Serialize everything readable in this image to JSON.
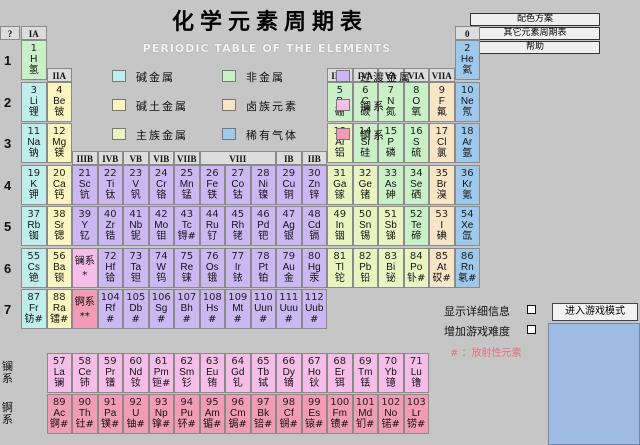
{
  "title": "化学元素周期表",
  "subtitle": "PERIODIC TABLE OF THE ELEMENTS",
  "menu": [
    "配色方案",
    "其它元素周期表",
    "帮助"
  ],
  "question_mark": "?",
  "corner_zero": "0",
  "colors": {
    "alkali": "#bfeeed",
    "alkaline": "#fbf6bf",
    "transition": "#cbb8f2",
    "nonmetal": "#c9f0c6",
    "halogen": "#f8e5c5",
    "noble": "#9ec9ec",
    "poor": "#e9f4c1",
    "lanthanide": "#f6bde9",
    "actinide": "#f19bb6",
    "hydrogen": "#c9f0c6",
    "header": "#dcdcdc"
  },
  "legend": [
    {
      "label": "碱金属",
      "color": "#bfeeed"
    },
    {
      "label": "非金属",
      "color": "#c9f0c6"
    },
    {
      "label": "过渡金属",
      "color": "#cbb8f2"
    },
    {
      "label": "碱土金属",
      "color": "#fbf6bf"
    },
    {
      "label": "卤族元素",
      "color": "#f8e5c5"
    },
    {
      "label": "镧系",
      "color": "#f6bde9"
    },
    {
      "label": "主族金属",
      "color": "#e9f4c1"
    },
    {
      "label": "稀有气体",
      "color": "#9ec9ec"
    },
    {
      "label": "锕系",
      "color": "#f19bb6"
    }
  ],
  "periods": [
    "1",
    "2",
    "3",
    "4",
    "5",
    "6",
    "7"
  ],
  "group_headers": [
    {
      "label": "IA",
      "col": 1,
      "row": 0
    },
    {
      "label": "IIA",
      "col": 2,
      "row": 1
    },
    {
      "label": "IIIA",
      "col": 13,
      "row": 1
    },
    {
      "label": "IVA",
      "col": 14,
      "row": 1
    },
    {
      "label": "VA",
      "col": 15,
      "row": 1
    },
    {
      "label": "VIA",
      "col": 16,
      "row": 1
    },
    {
      "label": "VIIA",
      "col": 17,
      "row": 1
    },
    {
      "label": "IIIB",
      "col": 3,
      "row": 3
    },
    {
      "label": "IVB",
      "col": 4,
      "row": 3
    },
    {
      "label": "VB",
      "col": 5,
      "row": 3
    },
    {
      "label": "VIB",
      "col": 6,
      "row": 3
    },
    {
      "label": "VIIB",
      "col": 7,
      "row": 3
    },
    {
      "label": "VIII",
      "col": 8,
      "row": 3,
      "span": 3
    },
    {
      "label": "IB",
      "col": 11,
      "row": 3
    },
    {
      "label": "IIB",
      "col": 12,
      "row": 3
    }
  ],
  "elements": [
    {
      "n": "1",
      "s": "H",
      "c": "氢",
      "t": "hydrogen",
      "col": 1,
      "row": 1
    },
    {
      "n": "2",
      "s": "He",
      "c": "氦",
      "t": "noble",
      "col": 18,
      "row": 1
    },
    {
      "n": "3",
      "s": "Li",
      "c": "锂",
      "t": "alkali",
      "col": 1,
      "row": 2
    },
    {
      "n": "4",
      "s": "Be",
      "c": "铍",
      "t": "alkaline",
      "col": 2,
      "row": 2
    },
    {
      "n": "5",
      "s": "B",
      "c": "硼",
      "t": "nonmetal",
      "col": 13,
      "row": 2
    },
    {
      "n": "6",
      "s": "C",
      "c": "碳",
      "t": "nonmetal",
      "col": 14,
      "row": 2
    },
    {
      "n": "7",
      "s": "N",
      "c": "氮",
      "t": "nonmetal",
      "col": 15,
      "row": 2
    },
    {
      "n": "8",
      "s": "O",
      "c": "氧",
      "t": "nonmetal",
      "col": 16,
      "row": 2
    },
    {
      "n": "9",
      "s": "F",
      "c": "氟",
      "t": "halogen",
      "col": 17,
      "row": 2
    },
    {
      "n": "10",
      "s": "Ne",
      "c": "氖",
      "t": "noble",
      "col": 18,
      "row": 2
    },
    {
      "n": "11",
      "s": "Na",
      "c": "钠",
      "t": "alkali",
      "col": 1,
      "row": 3
    },
    {
      "n": "12",
      "s": "Mg",
      "c": "镁",
      "t": "alkaline",
      "col": 2,
      "row": 3
    },
    {
      "n": "13",
      "s": "Al",
      "c": "铝",
      "t": "poor",
      "col": 13,
      "row": 3
    },
    {
      "n": "14",
      "s": "Si",
      "c": "硅",
      "t": "nonmetal",
      "col": 14,
      "row": 3
    },
    {
      "n": "15",
      "s": "P",
      "c": "磷",
      "t": "nonmetal",
      "col": 15,
      "row": 3
    },
    {
      "n": "16",
      "s": "S",
      "c": "硫",
      "t": "nonmetal",
      "col": 16,
      "row": 3
    },
    {
      "n": "17",
      "s": "Cl",
      "c": "氯",
      "t": "halogen",
      "col": 17,
      "row": 3
    },
    {
      "n": "18",
      "s": "Ar",
      "c": "氩",
      "t": "noble",
      "col": 18,
      "row": 3
    },
    {
      "n": "19",
      "s": "K",
      "c": "钾",
      "t": "alkali",
      "col": 1,
      "row": 4
    },
    {
      "n": "20",
      "s": "Ca",
      "c": "钙",
      "t": "alkaline",
      "col": 2,
      "row": 4
    },
    {
      "n": "21",
      "s": "Sc",
      "c": "钪",
      "t": "transition",
      "col": 3,
      "row": 4
    },
    {
      "n": "22",
      "s": "Ti",
      "c": "钛",
      "t": "transition",
      "col": 4,
      "row": 4
    },
    {
      "n": "23",
      "s": "V",
      "c": "钒",
      "t": "transition",
      "col": 5,
      "row": 4
    },
    {
      "n": "24",
      "s": "Cr",
      "c": "铬",
      "t": "transition",
      "col": 6,
      "row": 4
    },
    {
      "n": "25",
      "s": "Mn",
      "c": "锰",
      "t": "transition",
      "col": 7,
      "row": 4
    },
    {
      "n": "26",
      "s": "Fe",
      "c": "铁",
      "t": "transition",
      "col": 8,
      "row": 4
    },
    {
      "n": "27",
      "s": "Co",
      "c": "钴",
      "t": "transition",
      "col": 9,
      "row": 4
    },
    {
      "n": "28",
      "s": "Ni",
      "c": "镍",
      "t": "transition",
      "col": 10,
      "row": 4
    },
    {
      "n": "29",
      "s": "Cu",
      "c": "铜",
      "t": "transition",
      "col": 11,
      "row": 4
    },
    {
      "n": "30",
      "s": "Zn",
      "c": "锌",
      "t": "transition",
      "col": 12,
      "row": 4
    },
    {
      "n": "31",
      "s": "Ga",
      "c": "镓",
      "t": "poor",
      "col": 13,
      "row": 4
    },
    {
      "n": "32",
      "s": "Ge",
      "c": "锗",
      "t": "poor",
      "col": 14,
      "row": 4
    },
    {
      "n": "33",
      "s": "As",
      "c": "砷",
      "t": "nonmetal",
      "col": 15,
      "row": 4
    },
    {
      "n": "34",
      "s": "Se",
      "c": "硒",
      "t": "nonmetal",
      "col": 16,
      "row": 4
    },
    {
      "n": "35",
      "s": "Br",
      "c": "溴",
      "t": "halogen",
      "col": 17,
      "row": 4
    },
    {
      "n": "36",
      "s": "Kr",
      "c": "氪",
      "t": "noble",
      "col": 18,
      "row": 4
    },
    {
      "n": "37",
      "s": "Rb",
      "c": "铷",
      "t": "alkali",
      "col": 1,
      "row": 5
    },
    {
      "n": "38",
      "s": "Sr",
      "c": "锶",
      "t": "alkaline",
      "col": 2,
      "row": 5
    },
    {
      "n": "39",
      "s": "Y",
      "c": "钇",
      "t": "transition",
      "col": 3,
      "row": 5
    },
    {
      "n": "40",
      "s": "Zr",
      "c": "锆",
      "t": "transition",
      "col": 4,
      "row": 5
    },
    {
      "n": "41",
      "s": "Nb",
      "c": "铌",
      "t": "transition",
      "col": 5,
      "row": 5
    },
    {
      "n": "42",
      "s": "Mo",
      "c": "钼",
      "t": "transition",
      "col": 6,
      "row": 5
    },
    {
      "n": "43",
      "s": "Tc",
      "c": "锝#",
      "t": "transition",
      "col": 7,
      "row": 5
    },
    {
      "n": "44",
      "s": "Ru",
      "c": "钌",
      "t": "transition",
      "col": 8,
      "row": 5
    },
    {
      "n": "45",
      "s": "Rh",
      "c": "铑",
      "t": "transition",
      "col": 9,
      "row": 5
    },
    {
      "n": "46",
      "s": "Pd",
      "c": "钯",
      "t": "transition",
      "col": 10,
      "row": 5
    },
    {
      "n": "47",
      "s": "Ag",
      "c": "银",
      "t": "transition",
      "col": 11,
      "row": 5
    },
    {
      "n": "48",
      "s": "Cd",
      "c": "镉",
      "t": "transition",
      "col": 12,
      "row": 5
    },
    {
      "n": "49",
      "s": "In",
      "c": "铟",
      "t": "poor",
      "col": 13,
      "row": 5
    },
    {
      "n": "50",
      "s": "Sn",
      "c": "锡",
      "t": "poor",
      "col": 14,
      "row": 5
    },
    {
      "n": "51",
      "s": "Sb",
      "c": "锑",
      "t": "poor",
      "col": 15,
      "row": 5
    },
    {
      "n": "52",
      "s": "Te",
      "c": "碲",
      "t": "nonmetal",
      "col": 16,
      "row": 5
    },
    {
      "n": "53",
      "s": "I",
      "c": "碘",
      "t": "halogen",
      "col": 17,
      "row": 5
    },
    {
      "n": "54",
      "s": "Xe",
      "c": "氙",
      "t": "noble",
      "col": 18,
      "row": 5
    },
    {
      "n": "55",
      "s": "Cs",
      "c": "铯",
      "t": "alkali",
      "col": 1,
      "row": 6
    },
    {
      "n": "56",
      "s": "Ba",
      "c": "钡",
      "t": "alkaline",
      "col": 2,
      "row": 6
    },
    {
      "n": "",
      "s": "镧系",
      "c": "*",
      "t": "lanthanide",
      "col": 3,
      "row": 6
    },
    {
      "n": "72",
      "s": "Hf",
      "c": "铪",
      "t": "transition",
      "col": 4,
      "row": 6
    },
    {
      "n": "73",
      "s": "Ta",
      "c": "钽",
      "t": "transition",
      "col": 5,
      "row": 6
    },
    {
      "n": "74",
      "s": "W",
      "c": "钨",
      "t": "transition",
      "col": 6,
      "row": 6
    },
    {
      "n": "75",
      "s": "Re",
      "c": "铼",
      "t": "transition",
      "col": 7,
      "row": 6
    },
    {
      "n": "76",
      "s": "Os",
      "c": "锇",
      "t": "transition",
      "col": 8,
      "row": 6
    },
    {
      "n": "77",
      "s": "Ir",
      "c": "铱",
      "t": "transition",
      "col": 9,
      "row": 6
    },
    {
      "n": "78",
      "s": "Pt",
      "c": "铂",
      "t": "transition",
      "col": 10,
      "row": 6
    },
    {
      "n": "79",
      "s": "Au",
      "c": "金",
      "t": "transition",
      "col": 11,
      "row": 6
    },
    {
      "n": "80",
      "s": "Hg",
      "c": "汞",
      "t": "transition",
      "col": 12,
      "row": 6
    },
    {
      "n": "81",
      "s": "Tl",
      "c": "铊",
      "t": "poor",
      "col": 13,
      "row": 6
    },
    {
      "n": "82",
      "s": "Pb",
      "c": "铅",
      "t": "poor",
      "col": 14,
      "row": 6
    },
    {
      "n": "83",
      "s": "Bi",
      "c": "铋",
      "t": "poor",
      "col": 15,
      "row": 6
    },
    {
      "n": "84",
      "s": "Po",
      "c": "钋#",
      "t": "poor",
      "col": 16,
      "row": 6
    },
    {
      "n": "85",
      "s": "At",
      "c": "砹#",
      "t": "halogen",
      "col": 17,
      "row": 6
    },
    {
      "n": "86",
      "s": "Rn",
      "c": "氡#",
      "t": "noble",
      "col": 18,
      "row": 6
    },
    {
      "n": "87",
      "s": "Fr",
      "c": "钫#",
      "t": "alkali",
      "col": 1,
      "row": 7
    },
    {
      "n": "88",
      "s": "Ra",
      "c": "镭#",
      "t": "alkaline",
      "col": 2,
      "row": 7
    },
    {
      "n": "",
      "s": "锕系",
      "c": "**",
      "t": "actinide",
      "col": 3,
      "row": 7
    },
    {
      "n": "104",
      "s": "Rf",
      "c": "#",
      "t": "transition",
      "col": 4,
      "row": 7
    },
    {
      "n": "105",
      "s": "Db",
      "c": "#",
      "t": "transition",
      "col": 5,
      "row": 7
    },
    {
      "n": "106",
      "s": "Sg",
      "c": "#",
      "t": "transition",
      "col": 6,
      "row": 7
    },
    {
      "n": "107",
      "s": "Bh",
      "c": "#",
      "t": "transition",
      "col": 7,
      "row": 7
    },
    {
      "n": "108",
      "s": "Hs",
      "c": "#",
      "t": "transition",
      "col": 8,
      "row": 7
    },
    {
      "n": "109",
      "s": "Mt",
      "c": "#",
      "t": "transition",
      "col": 9,
      "row": 7
    },
    {
      "n": "110",
      "s": "Uun",
      "c": "#",
      "t": "transition",
      "col": 10,
      "row": 7
    },
    {
      "n": "111",
      "s": "Uuu",
      "c": "#",
      "t": "transition",
      "col": 11,
      "row": 7
    },
    {
      "n": "112",
      "s": "Uub",
      "c": "#",
      "t": "transition",
      "col": 12,
      "row": 7
    },
    {
      "n": "57",
      "s": "La",
      "c": "镧",
      "t": "lanthanide",
      "col": 2,
      "row": 8.5
    },
    {
      "n": "58",
      "s": "Ce",
      "c": "铈",
      "t": "lanthanide",
      "col": 3,
      "row": 8.5
    },
    {
      "n": "59",
      "s": "Pr",
      "c": "镨",
      "t": "lanthanide",
      "col": 4,
      "row": 8.5
    },
    {
      "n": "60",
      "s": "Nd",
      "c": "钕",
      "t": "lanthanide",
      "col": 5,
      "row": 8.5
    },
    {
      "n": "61",
      "s": "Pm",
      "c": "钷#",
      "t": "lanthanide",
      "col": 6,
      "row": 8.5
    },
    {
      "n": "62",
      "s": "Sm",
      "c": "钐",
      "t": "lanthanide",
      "col": 7,
      "row": 8.5
    },
    {
      "n": "63",
      "s": "Eu",
      "c": "铕",
      "t": "lanthanide",
      "col": 8,
      "row": 8.5
    },
    {
      "n": "64",
      "s": "Gd",
      "c": "钆",
      "t": "lanthanide",
      "col": 9,
      "row": 8.5
    },
    {
      "n": "65",
      "s": "Tb",
      "c": "铽",
      "t": "lanthanide",
      "col": 10,
      "row": 8.5
    },
    {
      "n": "66",
      "s": "Dy",
      "c": "镝",
      "t": "lanthanide",
      "col": 11,
      "row": 8.5
    },
    {
      "n": "67",
      "s": "Ho",
      "c": "钬",
      "t": "lanthanide",
      "col": 12,
      "row": 8.5
    },
    {
      "n": "68",
      "s": "Er",
      "c": "铒",
      "t": "lanthanide",
      "col": 13,
      "row": 8.5
    },
    {
      "n": "69",
      "s": "Tm",
      "c": "铥",
      "t": "lanthanide",
      "col": 14,
      "row": 8.5
    },
    {
      "n": "70",
      "s": "Yb",
      "c": "镱",
      "t": "lanthanide",
      "col": 15,
      "row": 8.5
    },
    {
      "n": "71",
      "s": "Lu",
      "c": "镥",
      "t": "lanthanide",
      "col": 16,
      "row": 8.5
    },
    {
      "n": "89",
      "s": "Ac",
      "c": "锕#",
      "t": "actinide",
      "col": 2,
      "row": 9.5
    },
    {
      "n": "90",
      "s": "Th",
      "c": "钍#",
      "t": "actinide",
      "col": 3,
      "row": 9.5
    },
    {
      "n": "91",
      "s": "Pa",
      "c": "镤#",
      "t": "actinide",
      "col": 4,
      "row": 9.5
    },
    {
      "n": "92",
      "s": "U",
      "c": "铀#",
      "t": "actinide",
      "col": 5,
      "row": 9.5
    },
    {
      "n": "93",
      "s": "Np",
      "c": "镎#",
      "t": "actinide",
      "col": 6,
      "row": 9.5
    },
    {
      "n": "94",
      "s": "Pu",
      "c": "钚#",
      "t": "actinide",
      "col": 7,
      "row": 9.5
    },
    {
      "n": "95",
      "s": "Am",
      "c": "镅#",
      "t": "actinide",
      "col": 8,
      "row": 9.5
    },
    {
      "n": "96",
      "s": "Cm",
      "c": "锔#",
      "t": "actinide",
      "col": 9,
      "row": 9.5
    },
    {
      "n": "97",
      "s": "Bk",
      "c": "锫#",
      "t": "actinide",
      "col": 10,
      "row": 9.5
    },
    {
      "n": "98",
      "s": "Cf",
      "c": "锎#",
      "t": "actinide",
      "col": 11,
      "row": 9.5
    },
    {
      "n": "99",
      "s": "Es",
      "c": "锿#",
      "t": "actinide",
      "col": 12,
      "row": 9.5
    },
    {
      "n": "100",
      "s": "Fm",
      "c": "镄#",
      "t": "actinide",
      "col": 13,
      "row": 9.5
    },
    {
      "n": "101",
      "s": "Md",
      "c": "钔#",
      "t": "actinide",
      "col": 14,
      "row": 9.5
    },
    {
      "n": "102",
      "s": "No",
      "c": "锘#",
      "t": "actinide",
      "col": 15,
      "row": 9.5
    },
    {
      "n": "103",
      "s": "Lr",
      "c": "铹#",
      "t": "actinide",
      "col": 16,
      "row": 9.5
    }
  ],
  "series_labels": [
    "镧系",
    "锕系"
  ],
  "options": [
    {
      "label": "显示详细信息",
      "checked": false
    },
    {
      "label": "增加游戏难度",
      "checked": false
    }
  ],
  "radioactive_note": "# ：放射性元素",
  "game_button": "进入游戏模式"
}
